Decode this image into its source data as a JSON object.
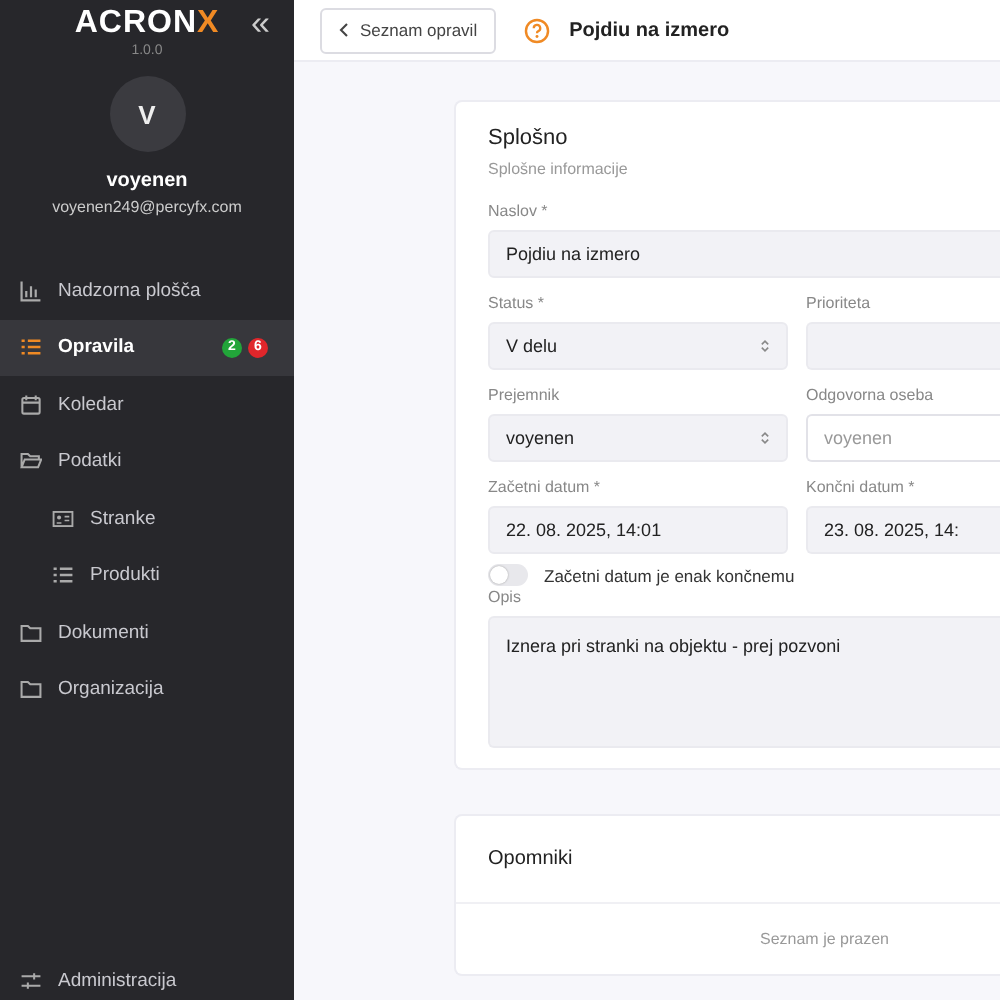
{
  "sidebar": {
    "logo": {
      "text": "ACRON",
      "accent": "X"
    },
    "version": "1.0.0",
    "collapse_icon": "«",
    "user": {
      "initial": "V",
      "name": "voyenen",
      "email": "voyenen249@percyfx.com"
    },
    "items": [
      {
        "label": "Nadzorna plošča",
        "selected": false
      },
      {
        "label": "Opravila",
        "selected": true,
        "badges": [
          {
            "text": "2",
            "color": "#22a53a"
          },
          {
            "text": "6",
            "color": "#e0262b"
          }
        ]
      },
      {
        "label": "Koledar",
        "selected": false
      },
      {
        "label": "Podatki",
        "selected": false,
        "expanded": true,
        "children": [
          {
            "label": "Stranke",
            "selected": false
          },
          {
            "label": "Produkti",
            "selected": false
          }
        ]
      },
      {
        "label": "Dokumenti",
        "selected": false
      },
      {
        "label": "Organizacija",
        "selected": false
      }
    ],
    "bottom_item": {
      "label": "Administracija"
    }
  },
  "header": {
    "back_button": "Seznam opravil",
    "title": "Pojdiu na izmero"
  },
  "general": {
    "title": "Splošno",
    "subtitle": "Splošne informacije",
    "rows": [
      [
        {
          "kind": "text",
          "label": "Naslov *",
          "value": "Pojdiu na izmero"
        }
      ],
      [
        {
          "kind": "select",
          "label": "Status *",
          "value": "V delu"
        },
        {
          "kind": "select",
          "label": "Prioriteta"
        }
      ],
      [
        {
          "kind": "select",
          "label": "Prejemnik",
          "value": "voyenen"
        },
        {
          "kind": "text",
          "label": "Odgovorna oseba",
          "value": "voyenen",
          "disabled": true
        }
      ],
      [
        {
          "kind": "text",
          "label": "Začetni datum *",
          "value": "22. 08. 2025, 14:01"
        },
        {
          "kind": "text",
          "label": "Končni datum *",
          "value": "23. 08. 2025, 14:"
        }
      ]
    ],
    "toggle": {
      "label": "Začetni datum je enak končnemu",
      "on": false
    },
    "description": {
      "label": "Opis",
      "value": "Iznera pri stranki na objektu - prej pozvoni"
    }
  },
  "reminders": {
    "title": "Opomniki",
    "empty_text": "Seznam je prazen"
  }
}
